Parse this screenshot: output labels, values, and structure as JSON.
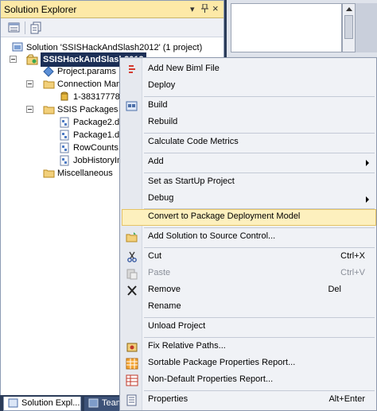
{
  "pane": {
    "title": "Solution Explorer",
    "pin_glyph": "§",
    "close_glyph": "×",
    "dropdown_glyph": "▾"
  },
  "tree": {
    "solution": "Solution 'SSISHackAndSlash2012' (1 project)",
    "project": "SSISHackAndSlash2012",
    "project_params": "Project.params",
    "connection_managers": "Connection Mana",
    "connection_item": "1-38317778",
    "ssis_packages": "SSIS Packages",
    "package2": "Package2.dt",
    "package1": "Package1.dt",
    "rowcounts": "RowCounts.c",
    "jobhistory": "JobHistoryIm",
    "miscellaneous": "Miscellaneous"
  },
  "bottom_tabs": {
    "solution_explorer": "Solution Expl...",
    "team": "Team"
  },
  "menu": {
    "add_biml": "Add New Biml File",
    "deploy": "Deploy",
    "build": "Build",
    "rebuild": "Rebuild",
    "calc_metrics": "Calculate Code Metrics",
    "add": "Add",
    "set_startup": "Set as StartUp Project",
    "debug": "Debug",
    "convert": "Convert to Package Deployment Model",
    "add_source_control": "Add Solution to Source Control...",
    "cut": "Cut",
    "cut_shortcut": "Ctrl+X",
    "paste": "Paste",
    "paste_shortcut": "Ctrl+V",
    "remove": "Remove",
    "remove_shortcut": "Del",
    "rename": "Rename",
    "unload": "Unload Project",
    "fix_paths": "Fix Relative Paths...",
    "sortable_report": "Sortable Package Properties Report...",
    "nondefault_report": "Non-Default Properties Report...",
    "properties": "Properties",
    "properties_shortcut": "Alt+Enter"
  },
  "colors": {
    "title_bar": "#fde9a7",
    "selection": "#1c2f56",
    "menu_highlight": "#fdf0be",
    "frame": "#2b3c59"
  }
}
